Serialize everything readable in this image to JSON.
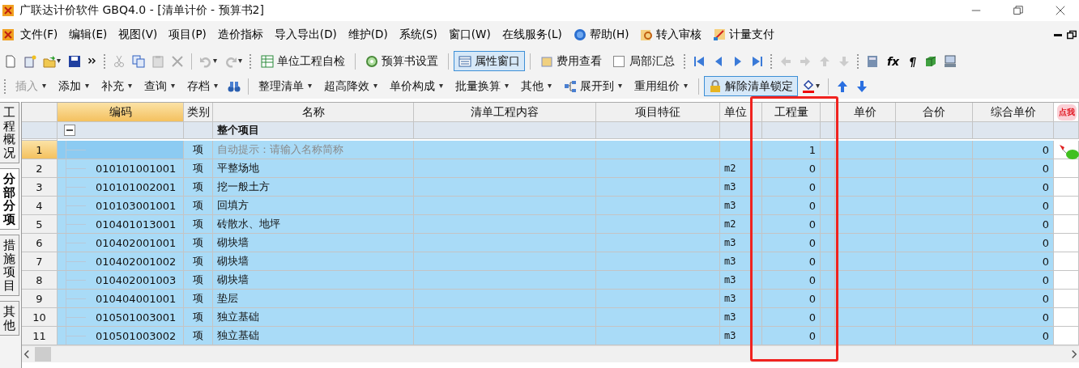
{
  "window": {
    "title": "广联达计价软件 GBQ4.0 - [清单计价 - 预算书2]"
  },
  "menu": [
    "文件(F)",
    "编辑(E)",
    "视图(V)",
    "项目(P)",
    "造价指标",
    "导入导出(D)",
    "维护(D)",
    "系统(S)",
    "窗口(W)",
    "在线服务(L)",
    "帮助(H)",
    "转入审核",
    "计量支付"
  ],
  "toolbar": {
    "buttons": [
      {
        "label": "单位工程自检",
        "pressed": false
      },
      {
        "label": "预算书设置",
        "pressed": false
      },
      {
        "label": "属性窗口",
        "pressed": true
      },
      {
        "label": "费用查看",
        "pressed": false
      }
    ],
    "summary": {
      "label": "局部汇总",
      "checked": false
    },
    "symbols": [
      "fx",
      "¶"
    ]
  },
  "toolbar2": [
    {
      "label": "插入",
      "disabled": true,
      "pressed": false
    },
    {
      "label": "添加",
      "disabled": false,
      "pressed": false
    },
    {
      "label": "补充",
      "disabled": false,
      "pressed": false
    },
    {
      "label": "查询",
      "disabled": false,
      "pressed": false
    },
    {
      "label": "存档",
      "disabled": false,
      "pressed": false
    },
    {
      "label": "整理清单",
      "disabled": false,
      "pressed": false
    },
    {
      "label": "超高降效",
      "disabled": false,
      "pressed": false
    },
    {
      "label": "单价构成",
      "disabled": false,
      "pressed": false
    },
    {
      "label": "批量换算",
      "disabled": false,
      "pressed": false
    },
    {
      "label": "其他",
      "disabled": false,
      "pressed": false
    },
    {
      "label": "展开到",
      "disabled": false,
      "pressed": false
    },
    {
      "label": "重用组价",
      "disabled": false,
      "pressed": false
    },
    {
      "label": "解除清单锁定",
      "disabled": false,
      "pressed": true
    }
  ],
  "side_tabs": [
    {
      "label": "工程概况",
      "selected": false
    },
    {
      "label": "分部分项",
      "selected": true
    },
    {
      "label": "措施项目",
      "selected": false
    },
    {
      "label": "其他",
      "selected": false
    }
  ],
  "sticker": "点我",
  "table": {
    "columns": [
      {
        "label": "编码",
        "selected": true
      },
      {
        "label": "类别",
        "selected": false
      },
      {
        "label": "名称",
        "selected": false
      },
      {
        "label": "清单工程内容",
        "selected": false
      },
      {
        "label": "项目特征",
        "selected": false
      },
      {
        "label": "单位",
        "selected": false
      },
      {
        "label": "工程量",
        "selected": false
      },
      {
        "label": "单价",
        "selected": false
      },
      {
        "label": "合价",
        "selected": false
      },
      {
        "label": "综合单价",
        "selected": false
      }
    ],
    "group": {
      "name": "整个项目",
      "expanded": true
    },
    "rows": [
      {
        "number": "1",
        "type": "项",
        "name": "自动提示：请输入名称简称",
        "hint": true,
        "quantity": "1",
        "total_unit_price": "0",
        "current": true,
        "selected": true
      },
      {
        "number": "2",
        "code": "010101001001",
        "type": "项",
        "name": "平整场地",
        "hint": false,
        "unit": "m2",
        "quantity": "0",
        "total_unit_price": "0",
        "current": false,
        "selected": true
      },
      {
        "number": "3",
        "code": "010101002001",
        "type": "项",
        "name": "挖一般土方",
        "hint": false,
        "unit": "m3",
        "quantity": "0",
        "total_unit_price": "0",
        "current": false,
        "selected": true
      },
      {
        "number": "4",
        "code": "010103001001",
        "type": "项",
        "name": "回填方",
        "hint": false,
        "unit": "m3",
        "quantity": "0",
        "total_unit_price": "0",
        "current": false,
        "selected": true
      },
      {
        "number": "5",
        "code": "010401013001",
        "type": "项",
        "name": "砖散水、地坪",
        "hint": false,
        "unit": "m2",
        "quantity": "0",
        "total_unit_price": "0",
        "current": false,
        "selected": true
      },
      {
        "number": "6",
        "code": "010402001001",
        "type": "项",
        "name": "砌块墙",
        "hint": false,
        "unit": "m3",
        "quantity": "0",
        "total_unit_price": "0",
        "current": false,
        "selected": true
      },
      {
        "number": "7",
        "code": "010402001002",
        "type": "项",
        "name": "砌块墙",
        "hint": false,
        "unit": "m3",
        "quantity": "0",
        "total_unit_price": "0",
        "current": false,
        "selected": true
      },
      {
        "number": "8",
        "code": "010402001003",
        "type": "项",
        "name": "砌块墙",
        "hint": false,
        "unit": "m3",
        "quantity": "0",
        "total_unit_price": "0",
        "current": false,
        "selected": true
      },
      {
        "number": "9",
        "code": "010404001001",
        "type": "项",
        "name": "垫层",
        "hint": false,
        "unit": "m3",
        "quantity": "0",
        "total_unit_price": "0",
        "current": false,
        "selected": true
      },
      {
        "number": "10",
        "code": "010501003001",
        "type": "项",
        "name": "独立基础",
        "hint": false,
        "unit": "m3",
        "quantity": "0",
        "total_unit_price": "0",
        "current": false,
        "selected": true
      },
      {
        "number": "11",
        "code": "010501003002",
        "type": "项",
        "name": "独立基础",
        "hint": false,
        "unit": "m3",
        "quantity": "0",
        "total_unit_price": "0",
        "current": false,
        "selected": true
      }
    ]
  }
}
